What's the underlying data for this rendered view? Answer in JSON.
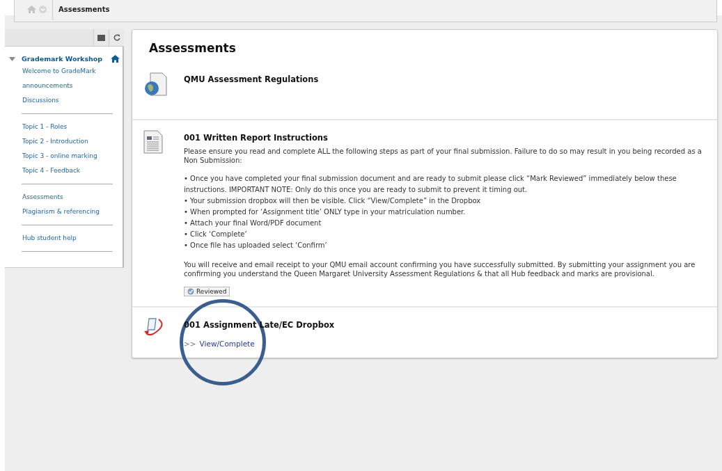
{
  "breadcrumb": {
    "current": "Assessments"
  },
  "sidebar": {
    "header": {
      "title": "Grademark Workshop",
      "expanded": true
    },
    "groups": [
      {
        "items": [
          "Welcome to GradeMark",
          "announcements",
          "Discussions"
        ]
      },
      {
        "items": [
          "Topic 1 - Roles",
          "Topic 2 - Introduction",
          "Topic 3 - online marking",
          "Topic 4 - Feedback"
        ]
      },
      {
        "items": [
          "Assessments",
          "Plagiarism & referencing"
        ]
      },
      {
        "items": [
          "Hub student help"
        ]
      }
    ]
  },
  "main": {
    "title": "Assessments",
    "items": [
      {
        "kind": "link",
        "title": "QMU Assessment Regulations"
      },
      {
        "kind": "instructions",
        "title": "001 Written Report Instructions",
        "intro": "Please ensure you read and complete ALL the following steps as part of your final submission. Failure to do so may result in you being recorded as a Non Submission:",
        "bullets": [
          "• Once you have completed your final submission document and are ready to submit please click “Mark Reviewed” immediately below these instructions. IMPORTANT NOTE: Only do this once you are ready to submit to prevent it timing out.",
          "• Your submission dropbox will then be visible. Click “View/Complete” in the Dropbox",
          "• When prompted for ‘Assignment title’ ONLY type in your matriculation number.",
          "• Attach your final Word/PDF document",
          "• Click ‘Complete’",
          "• Once file has uploaded select ‘Confirm’"
        ],
        "closing": "You will receive and email receipt to your QMU email account confirming you have successfully submitted. By submitting your assignment you are confirming you understand the Queen Margaret University Assessment Regulations & that all Hub feedback and marks are provisional.",
        "button": "Reviewed"
      },
      {
        "kind": "dropbox",
        "title": "001 Assignment Late/EC Dropbox",
        "prefix": ">>",
        "link": "View/Complete",
        "highlighted": true
      }
    ]
  }
}
